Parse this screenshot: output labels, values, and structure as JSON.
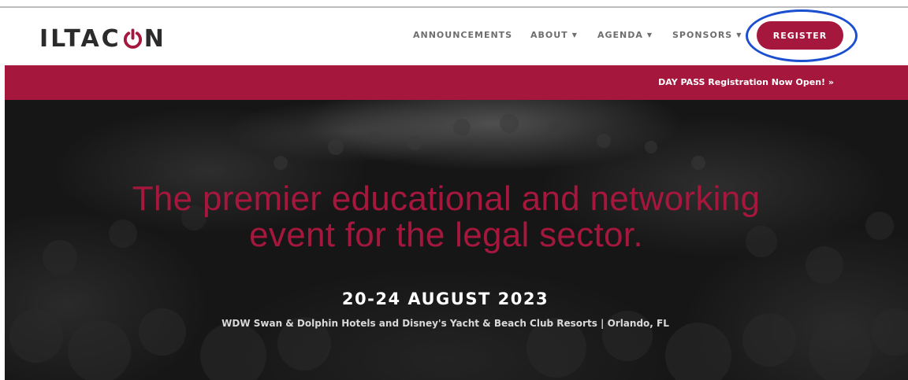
{
  "header": {
    "logo_text_start": "ILTAC",
    "logo_text_end": "N",
    "logo_full": "ILTACON",
    "logo_icon": "power-icon"
  },
  "nav": {
    "items": [
      {
        "label": "ANNOUNCEMENTS",
        "has_dropdown": false
      },
      {
        "label": "ABOUT",
        "has_dropdown": true
      },
      {
        "label": "AGENDA",
        "has_dropdown": true
      },
      {
        "label": "SPONSORS",
        "has_dropdown": true
      }
    ],
    "register_label": "REGISTER"
  },
  "promo": {
    "link_text": "DAY PASS Registration Now Open! »"
  },
  "hero": {
    "headline_line1": "The premier educational and networking",
    "headline_line2": "event for the legal sector.",
    "dates": "20-24 AUGUST 2023",
    "venue": "WDW Swan & Dolphin Hotels and Disney's Yacht & Beach Club Resorts | Orlando, FL"
  },
  "colors": {
    "brand": "#a5173d",
    "annotation": "#1c4fd0",
    "nav_text": "#6e6e6e",
    "hero_background": "#161616"
  }
}
